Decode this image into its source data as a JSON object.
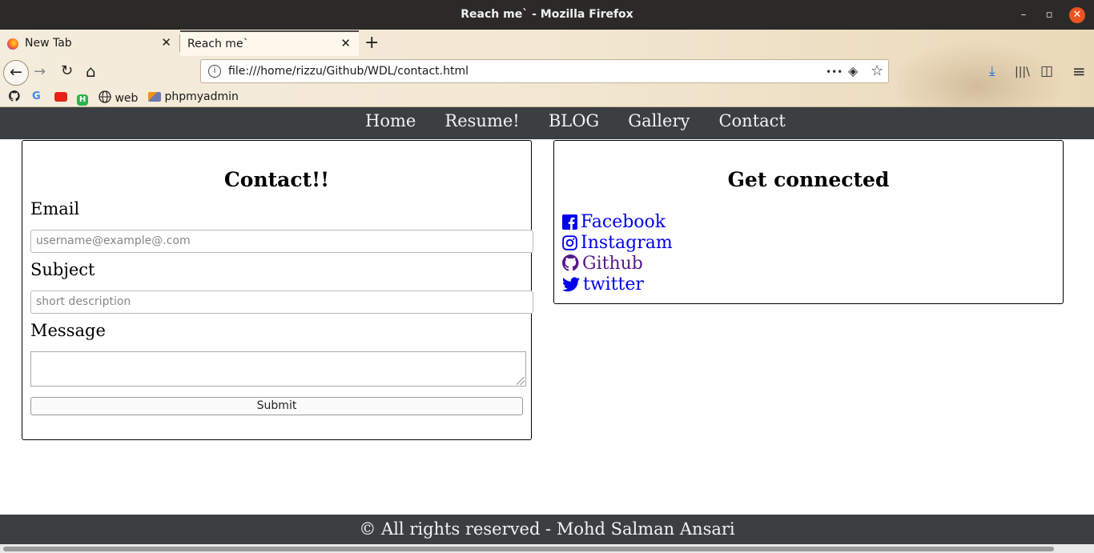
{
  "window": {
    "title": "Reach me` - Mozilla Firefox",
    "minimize_glyph": "–",
    "maximize_glyph": "▫",
    "close_glyph": "✕"
  },
  "tabs": [
    {
      "label": "New Tab",
      "active": false,
      "close": "✕"
    },
    {
      "label": "Reach me`",
      "active": true,
      "close": "✕"
    }
  ],
  "newtab_glyph": "+",
  "toolbar": {
    "back": "←",
    "forward": "→",
    "reload": "↻",
    "home": "⌂",
    "url": "file:///home/rizzu/Github/WDL/contact.html",
    "info_glyph": "i",
    "more": "•••",
    "pocket": "◈",
    "star": "☆",
    "download": "⤓",
    "library": "|||\\",
    "sidebar": "◫",
    "menu": "≡"
  },
  "bookmarks": [
    {
      "label": "",
      "icon": "github-icon"
    },
    {
      "label": "",
      "icon": "google-icon"
    },
    {
      "label": "",
      "icon": "youtube-icon"
    },
    {
      "label": "",
      "icon": "h-icon"
    },
    {
      "label": "web",
      "icon": "globe-icon"
    },
    {
      "label": "phpmyadmin",
      "icon": "phpmyadmin-icon"
    }
  ],
  "site_nav": [
    "Home",
    "Resume!",
    "BLOG",
    "Gallery",
    "Contact"
  ],
  "contact_form": {
    "heading": "Contact!!",
    "email_label": "Email",
    "email_placeholder": "username@example@.com",
    "subject_label": "Subject",
    "subject_placeholder": "short description",
    "message_label": "Message",
    "submit_label": "Submit"
  },
  "social": {
    "heading": "Get connected",
    "links": [
      {
        "label": "Facebook",
        "icon": "facebook-icon"
      },
      {
        "label": "Instagram",
        "icon": "instagram-icon"
      },
      {
        "label": "Github",
        "icon": "github-icon",
        "visited": true
      },
      {
        "label": "twitter",
        "icon": "twitter-icon"
      }
    ]
  },
  "footer": {
    "text": "© All rights reserved - Mohd Salman Ansari"
  },
  "colors": {
    "nav_bg": "#3b3f42",
    "link": "#0000ee",
    "visited": "#551a8b",
    "close_button": "#e95420"
  }
}
